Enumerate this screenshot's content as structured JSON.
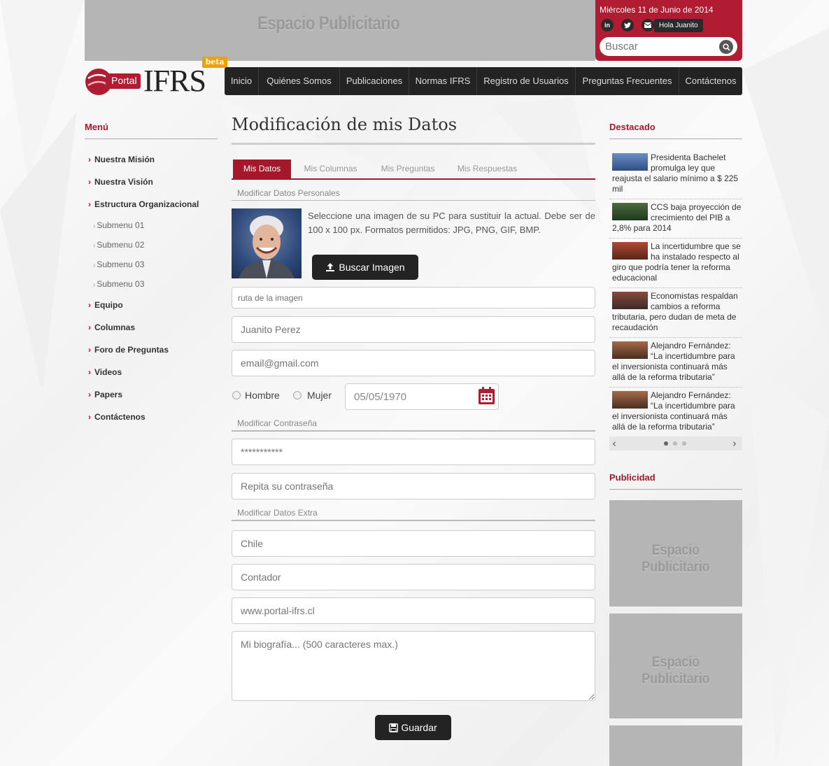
{
  "banner": {
    "ad_text": "Espacio Publicitario"
  },
  "user_box": {
    "date": "Miércoles 11 de Junio de 2014",
    "social": [
      "in",
      "t",
      "mail"
    ],
    "greeting": "Hola Juanito",
    "search_placeholder": "Buscar"
  },
  "logo": {
    "portal": "Portal",
    "ifrs": "IFRS",
    "beta": "beta"
  },
  "nav": [
    "Inicio",
    "Quiénes Somos",
    "Publicaciones",
    "Normas IFRS",
    "Registro de Usuarios",
    "Preguntas Frecuentes",
    "Contáctenos"
  ],
  "left_menu": {
    "title": "Menú",
    "items": [
      "Nuestra Misión",
      "Nuestra Visión",
      "Estructura Organizacional"
    ],
    "submenu": [
      "Submenu 01",
      "Submenu 02",
      "Submenu 03",
      "Submenu 03"
    ],
    "items_after": [
      "Equipo",
      "Columnas",
      "Foro de Preguntas",
      "Videos",
      "Papers",
      "Contáctenos"
    ]
  },
  "main": {
    "title": "Modificación de mis Datos",
    "tabs": [
      "Mis Datos",
      "Mis Columnas",
      "Mis Preguntas",
      "Mis Respuestas"
    ],
    "personal_label": "Modificar Datos Personales",
    "image_help": "Seleccione una imagen de su PC para sustituir la actual. Debe ser de 100 x 100 px. Formatos permitidos: JPG, PNG, GIF, BMP.",
    "browse_button": "Buscar Imagen",
    "image_path_placeholder": "ruta de la imagen",
    "name_placeholder": "Juanito Perez",
    "email_placeholder": "email@gmail.com",
    "gender_options": [
      "Hombre",
      "Mujer"
    ],
    "birth_date": "05/05/1970",
    "password_label": "Modificar Contraseña",
    "password_placeholder": "***********",
    "repeat_password_placeholder": "Repita su contraseña",
    "extra_label": "Modificar Datos Extra",
    "country_placeholder": "Chile",
    "profession_placeholder": "Contador",
    "website_placeholder": "www.portal-ifrs.cl",
    "bio_placeholder": "Mi biografía... (500 caracteres max.)",
    "save_button": "Guardar"
  },
  "featured": {
    "title": "Destacado",
    "items": [
      "Presidenta Bachelet promulga ley que reajusta el salario mínimo a $ 225 mil",
      "CCS baja proyección de crecimiento del PIB a 2,8% para 2014",
      "La incertidumbre que se ha instalado respecto al giro que podría tener la reforma educacional",
      "Economistas respaldan cambios a reforma tributaria, pero dudan de meta de recaudación",
      "Alejandro Fernández: “La incertidumbre para el inversionista continuará más allá de la reforma tributaria”",
      "Alejandro Fernández: “La incertidumbre para el inversionista continuará más allá de la reforma tributaria”"
    ]
  },
  "advertising": {
    "title": "Publicidad",
    "ad_text": "Espacio Publicitario"
  },
  "colors": {
    "brand_red": "#a5182c",
    "dark": "#232323",
    "ad_gray": "#b5b5b5"
  },
  "icons": [
    "linkedin-icon",
    "twitter-icon",
    "mail-icon",
    "search-icon",
    "upload-icon",
    "calendar-icon",
    "save-icon",
    "chevron-right-icon",
    "chevron-left-icon"
  ]
}
